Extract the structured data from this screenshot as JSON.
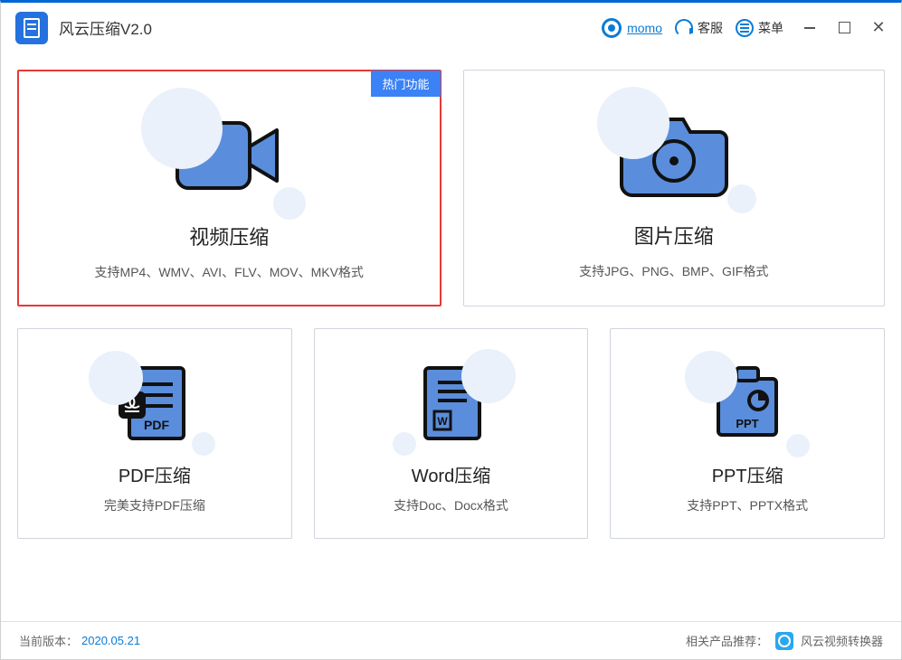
{
  "header": {
    "title": "风云压缩V2.0",
    "user": "momo",
    "service": "客服",
    "menu": "菜单"
  },
  "cards": {
    "video": {
      "badge": "热门功能",
      "title": "视频压缩",
      "desc": "支持MP4、WMV、AVI、FLV、MOV、MKV格式"
    },
    "image": {
      "title": "图片压缩",
      "desc": "支持JPG、PNG、BMP、GIF格式"
    },
    "pdf": {
      "title": "PDF压缩",
      "desc": "完美支持PDF压缩",
      "label": "PDF"
    },
    "word": {
      "title": "Word压缩",
      "desc": "支持Doc、Docx格式"
    },
    "ppt": {
      "title": "PPT压缩",
      "desc": "支持PPT、PPTX格式",
      "label": "PPT"
    }
  },
  "footer": {
    "version_label": "当前版本：",
    "version": "2020.05.21",
    "related_label": "相关产品推荐：",
    "related_product": "风云视频转换器"
  }
}
